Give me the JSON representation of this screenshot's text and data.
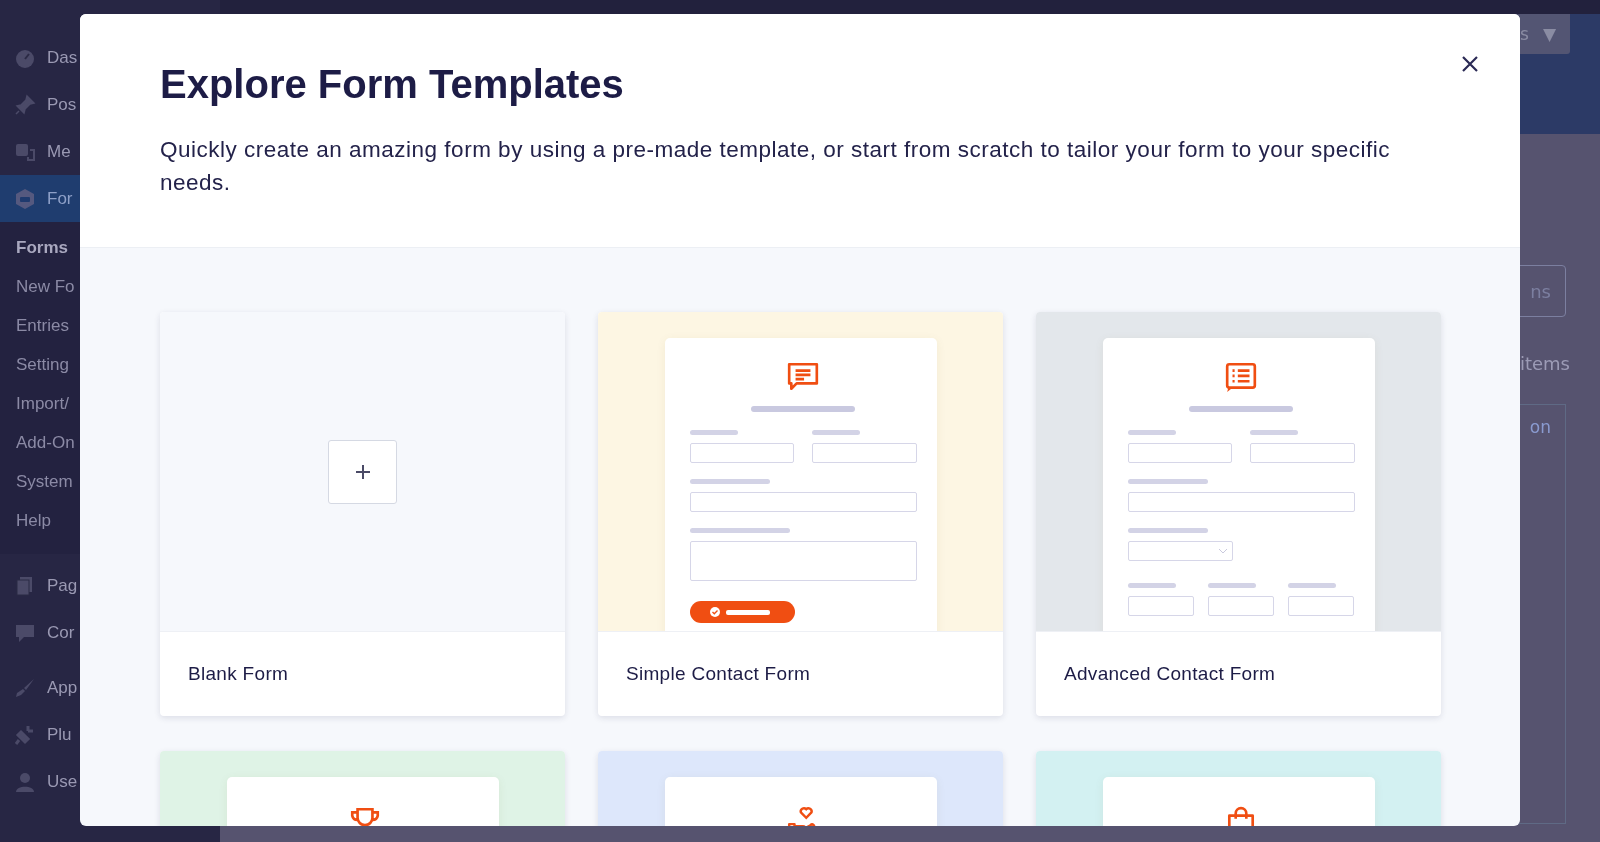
{
  "admin_menu": [
    {
      "label": "Das",
      "kind": "main",
      "selected": false
    },
    {
      "label": "Pos",
      "kind": "main",
      "selected": false
    },
    {
      "label": "Me",
      "kind": "main",
      "selected": false
    },
    {
      "label": "For",
      "kind": "main",
      "selected": true
    },
    {
      "label": "Forms",
      "kind": "sub",
      "selected": true
    },
    {
      "label": "New Fo",
      "kind": "sub",
      "selected": false
    },
    {
      "label": "Entries",
      "kind": "sub",
      "selected": false
    },
    {
      "label": "Setting",
      "kind": "sub",
      "selected": false
    },
    {
      "label": "Import/",
      "kind": "sub",
      "selected": false
    },
    {
      "label": "Add-On",
      "kind": "sub",
      "selected": false
    },
    {
      "label": "System",
      "kind": "sub",
      "selected": false
    },
    {
      "label": "Help",
      "kind": "sub",
      "selected": false
    },
    {
      "label": "Pag",
      "kind": "main",
      "selected": false
    },
    {
      "label": "Cor",
      "kind": "main",
      "selected": false
    },
    {
      "label": "App",
      "kind": "main",
      "selected": false
    },
    {
      "label": "Plu",
      "kind": "main",
      "selected": false
    },
    {
      "label": "Use",
      "kind": "main",
      "selected": false
    }
  ],
  "background_page": {
    "top_button": "s",
    "top_button_caret": "▼",
    "action_button": "ns",
    "items_count": "items",
    "table_link": "on"
  },
  "modal": {
    "title": "Explore Form Templates",
    "description": "Quickly create an amazing form by using a pre-made template, or start from scratch to tailor your form to your specific needs.",
    "templates": [
      {
        "title": "Blank Form",
        "kind": "blank"
      },
      {
        "title": "Simple Contact Form",
        "kind": "contact",
        "color": "#fdf6e3"
      },
      {
        "title": "Advanced Contact Form",
        "kind": "advanced",
        "color": "#e3e7eb"
      },
      {
        "kind": "trophy",
        "color": "#dff3e6"
      },
      {
        "kind": "charity",
        "color": "#dde7fb"
      },
      {
        "kind": "shopping",
        "color": "#d3f1f2"
      }
    ]
  }
}
